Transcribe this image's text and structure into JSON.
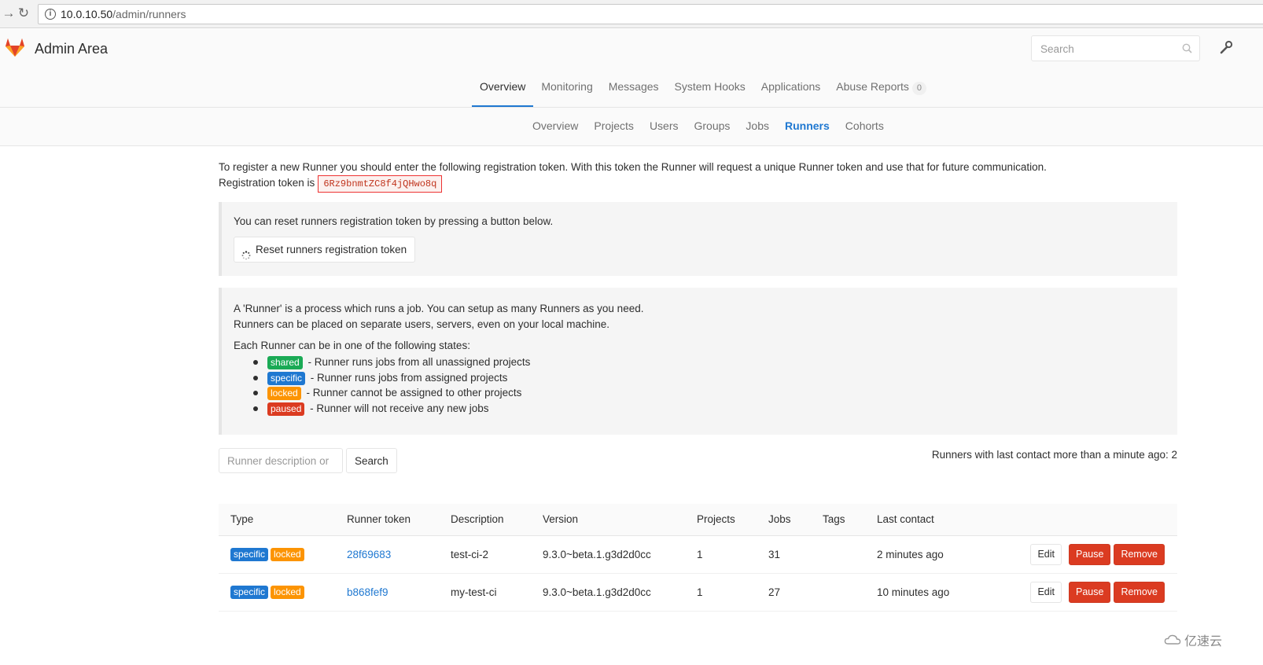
{
  "browser": {
    "url_host": "10.0.10.50",
    "url_path": "/admin/runners"
  },
  "header": {
    "title": "Admin Area",
    "search_placeholder": "Search"
  },
  "main_tabs": [
    {
      "label": "Overview",
      "active": true
    },
    {
      "label": "Monitoring"
    },
    {
      "label": "Messages"
    },
    {
      "label": "System Hooks"
    },
    {
      "label": "Applications"
    },
    {
      "label": "Abuse Reports",
      "count": "0"
    }
  ],
  "sub_tabs": [
    {
      "label": "Overview"
    },
    {
      "label": "Projects"
    },
    {
      "label": "Users"
    },
    {
      "label": "Groups"
    },
    {
      "label": "Jobs"
    },
    {
      "label": "Runners",
      "active": true
    },
    {
      "label": "Cohorts"
    }
  ],
  "intro": {
    "line1": "To register a new Runner you should enter the following registration token. With this token the Runner will request a unique Runner token and use that for future communication.",
    "line2_prefix": "Registration token is",
    "token": "6Rz9bnmtZC8f4jQHwo8q"
  },
  "reset": {
    "message": "You can reset runners registration token by pressing a button below.",
    "button": "Reset runners registration token"
  },
  "info": {
    "line1": "A 'Runner' is a process which runs a job. You can setup as many Runners as you need.",
    "line2": "Runners can be placed on separate users, servers, even on your local machine.",
    "states_title": "Each Runner can be in one of the following states:",
    "states": [
      {
        "label": "shared",
        "desc": "- Runner runs jobs from all unassigned projects"
      },
      {
        "label": "specific",
        "desc": "- Runner runs jobs from assigned projects"
      },
      {
        "label": "locked",
        "desc": "- Runner cannot be assigned to other projects"
      },
      {
        "label": "paused",
        "desc": "- Runner will not receive any new jobs"
      }
    ]
  },
  "filter": {
    "placeholder": "Runner description or",
    "search_button": "Search",
    "note": "Runners with last contact more than a minute ago: 2"
  },
  "table": {
    "headers": [
      "Type",
      "Runner token",
      "Description",
      "Version",
      "Projects",
      "Jobs",
      "Tags",
      "Last contact"
    ],
    "rows": [
      {
        "type1": "specific",
        "type2": "locked",
        "token": "28f69683",
        "description": "test-ci-2",
        "version": "9.3.0~beta.1.g3d2d0cc",
        "projects": "1",
        "jobs": "31",
        "tags": "",
        "last_contact": "2 minutes ago"
      },
      {
        "type1": "specific",
        "type2": "locked",
        "token": "b868fef9",
        "description": "my-test-ci",
        "version": "9.3.0~beta.1.g3d2d0cc",
        "projects": "1",
        "jobs": "27",
        "tags": "",
        "last_contact": "10 minutes ago"
      }
    ],
    "actions": {
      "edit": "Edit",
      "pause": "Pause",
      "remove": "Remove"
    }
  },
  "watermark": "亿速云",
  "colors": {
    "accent": "#1f78d1",
    "shared": "#1aaa55",
    "specific": "#1f78d1",
    "locked": "#fc9403",
    "paused": "#db3b21",
    "token": "#c0341d"
  }
}
